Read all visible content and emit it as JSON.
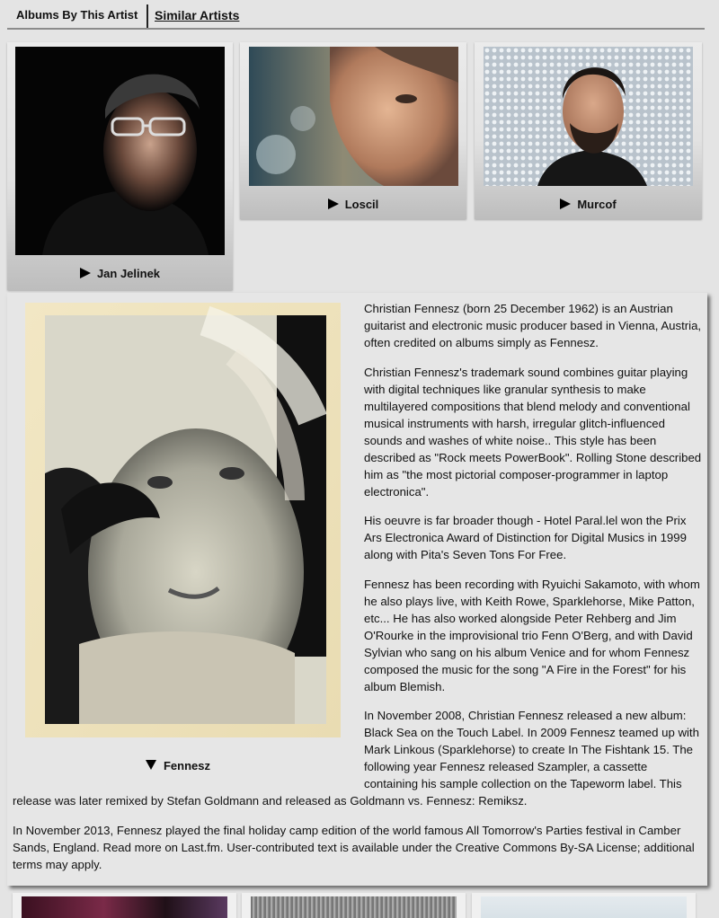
{
  "tabs": {
    "albums_label": "Albums By This Artist",
    "similar_label": "Similar Artists"
  },
  "similar_artists": [
    {
      "name": "Jan Jelinek",
      "icon": "play-icon"
    },
    {
      "name": "Loscil",
      "icon": "play-icon"
    },
    {
      "name": "Murcof",
      "icon": "play-icon"
    }
  ],
  "artist": {
    "name": "Fennesz",
    "caption_icon": "triangle-down-icon",
    "bio": [
      "Christian Fennesz (born 25 December 1962) is an Austrian guitarist and electronic music producer based in Vienna, Austria, often credited on albums simply as Fennesz.",
      "Christian Fennesz's trademark sound combines guitar playing with digital techniques like granular synthesis to make multilayered compositions that blend melody and conventional musical instruments with harsh, irregular glitch-influenced sounds and washes of white noise.. This style has been described as \"Rock meets PowerBook\". Rolling Stone described him as \"the most pictorial composer-programmer in laptop electronica\".",
      "His oeuvre is far broader though - Hotel Paral.lel won the Prix Ars Electronica Award of Distinction for Digital Musics in 1999 along with Pita's Seven Tons For Free.",
      "Fennesz has been recording with Ryuichi Sakamoto, with whom he also plays live, with Keith Rowe, Sparklehorse, Mike Patton, etc... He has also worked alongside Peter Rehberg and Jim O'Rourke in the improvisional trio Fenn O'Berg, and with David Sylvian who sang on his album Venice and for whom Fennesz composed the music for the song \"A Fire in the Forest\" for his album Blemish.",
      "In November 2008, Christian Fennesz released a new album: Black Sea on the Touch Label. In 2009 Fennesz teamed up with Mark Linkous (Sparklehorse) to create In The Fishtank 15. The following year Fennesz released Szampler, a cassette containing his sample collection on the Tapeworm label. This release was later remixed by Stefan Goldmann and released as Goldmann vs. Fennesz: Remiksz.",
      "In November 2013, Fennesz played the final holiday camp edition of the world famous All Tomorrow's Parties festival in Camber Sands, England. Read more on Last.fm. User-contributed text is available under the Creative Commons By-SA License; additional terms may apply."
    ]
  },
  "colors": {
    "page_bg": "#e4e4e4",
    "panel_bg": "#e6e6e6",
    "text": "#111111",
    "divider": "#8c8c8c"
  }
}
